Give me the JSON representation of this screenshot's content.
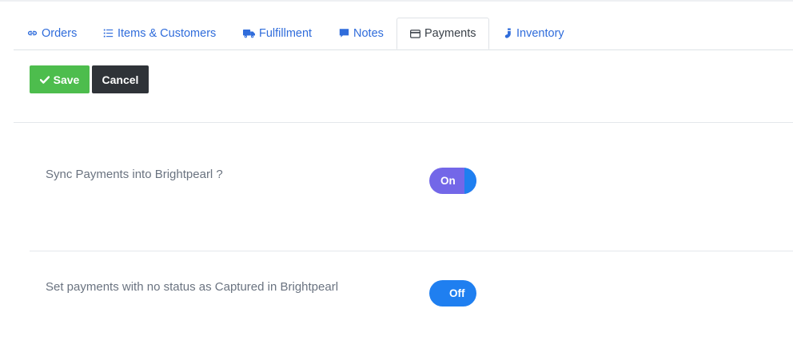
{
  "tabs": [
    {
      "label": "Orders",
      "icon": "link-icon"
    },
    {
      "label": "Items & Customers",
      "icon": "list-icon"
    },
    {
      "label": "Fulfillment",
      "icon": "truck-icon"
    },
    {
      "label": "Notes",
      "icon": "comment-icon"
    },
    {
      "label": "Payments",
      "icon": "credit-card-icon",
      "active": true
    },
    {
      "label": "Inventory",
      "icon": "sock-icon"
    }
  ],
  "toolbar": {
    "save_label": "Save",
    "cancel_label": "Cancel"
  },
  "settings": [
    {
      "label": "Sync Payments into Brightpearl ?",
      "toggle_text": "On",
      "state": "on"
    },
    {
      "label": "Set payments with no status as Captured in Brightpearl",
      "toggle_text": "Off",
      "state": "off"
    }
  ],
  "colors": {
    "accent": "#2f6cdb",
    "save": "#4dbd4d",
    "cancel": "#2f3338",
    "toggle_on": "#7367e8",
    "toggle_off": "#1f7ff0"
  }
}
